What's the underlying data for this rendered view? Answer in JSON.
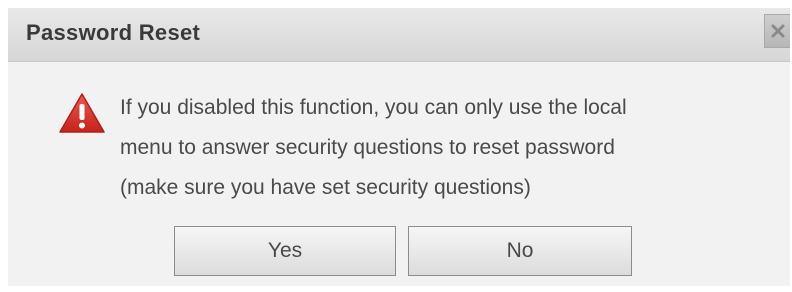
{
  "dialog": {
    "title": "Password Reset",
    "close_icon": "close-icon",
    "warning_icon": "warning-triangle-icon",
    "message_lines": [
      "If you disabled this function, you can only use the local",
      "menu to answer security questions to reset password",
      "(make sure you have set security questions)"
    ],
    "buttons": {
      "yes_label": "Yes",
      "no_label": "No"
    },
    "colors": {
      "warning": "#d9342b",
      "text": "#4a4a4a",
      "background": "#efefef"
    }
  }
}
